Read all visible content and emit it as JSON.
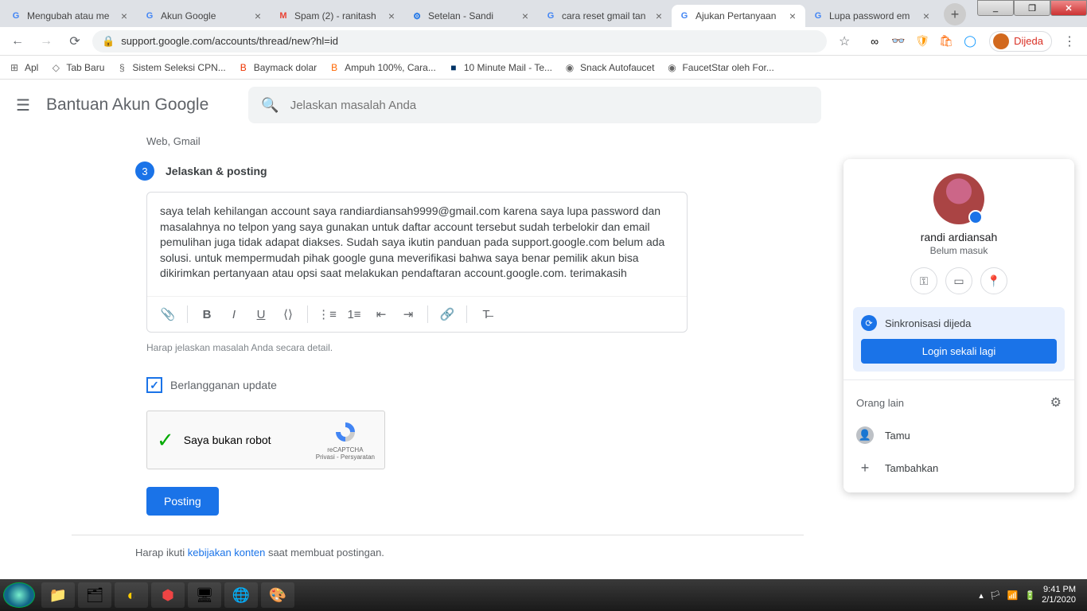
{
  "window": {
    "minimize": "_",
    "maximize": "❐",
    "close": "✕"
  },
  "tabs": [
    {
      "title": "Mengubah atau me",
      "favicon": "G",
      "color": "#4285f4"
    },
    {
      "title": "Akun Google",
      "favicon": "G",
      "color": "#4285f4"
    },
    {
      "title": "Spam (2) - ranitash",
      "favicon": "M",
      "color": "#ea4335"
    },
    {
      "title": "Setelan - Sandi",
      "favicon": "⚙",
      "color": "#1a73e8"
    },
    {
      "title": "cara reset gmail tan",
      "favicon": "G",
      "color": "#4285f4"
    },
    {
      "title": "Ajukan Pertanyaan",
      "favicon": "G",
      "color": "#4285f4",
      "active": true
    },
    {
      "title": "Lupa password em",
      "favicon": "G",
      "color": "#4285f4"
    }
  ],
  "omnibox": {
    "url": "support.google.com/accounts/thread/new?hl=id"
  },
  "profile_chip": {
    "label": "Dijeda"
  },
  "bookmarks": [
    {
      "label": "Apl",
      "icon": "⊞"
    },
    {
      "label": "Tab Baru",
      "icon": "◇"
    },
    {
      "label": "Sistem Seleksi CPN...",
      "icon": "§"
    },
    {
      "label": "Baymack dolar",
      "icon": "B",
      "color": "#e30"
    },
    {
      "label": "Ampuh 100%, Cara...",
      "icon": "B",
      "color": "#f60"
    },
    {
      "label": "10 Minute Mail - Te...",
      "icon": "■",
      "color": "#036"
    },
    {
      "label": "Snack Autofaucet",
      "icon": "◉"
    },
    {
      "label": "FaucetStar oleh For...",
      "icon": "◉"
    }
  ],
  "header": {
    "title": "Bantuan Akun Google",
    "search_placeholder": "Jelaskan masalah Anda"
  },
  "form": {
    "meta": "Web, Gmail",
    "step_num": "3",
    "step_label": "Jelaskan & posting",
    "body": "saya telah kehilangan account saya randiardiansah9999@gmail.com karena saya lupa password dan masalahnya no telpon yang saya gunakan untuk daftar account tersebut sudah terbelokir dan email pemulihan juga tidak adapat diakses. Sudah saya ikutin panduan pada support.google.com belum ada solusi. untuk mempermudah pihak google guna meverifikasi bahwa saya benar pemilik akun bisa dikirimkan pertanyaan atau opsi saat melakukan pendaftaran account.google.com. terimakasih",
    "helper": "Harap jelaskan masalah Anda secara detail.",
    "checkbox": "Berlangganan update",
    "recaptcha": "Saya bukan robot",
    "recaptcha_brand": "reCAPTCHA",
    "recaptcha_terms": "Privasi - Persyaratan",
    "submit": "Posting",
    "policy_prefix": "Harap ikuti ",
    "policy_link": "kebijakan konten",
    "policy_suffix": " saat membuat postingan."
  },
  "profile_menu": {
    "name": "randi ardiansah",
    "status": "Belum masuk",
    "sync": "Sinkronisasi dijeda",
    "login": "Login sekali lagi",
    "others": "Orang lain",
    "guest": "Tamu",
    "add": "Tambahkan"
  },
  "clock": {
    "time": "9:41 PM",
    "date": "2/1/2020"
  }
}
